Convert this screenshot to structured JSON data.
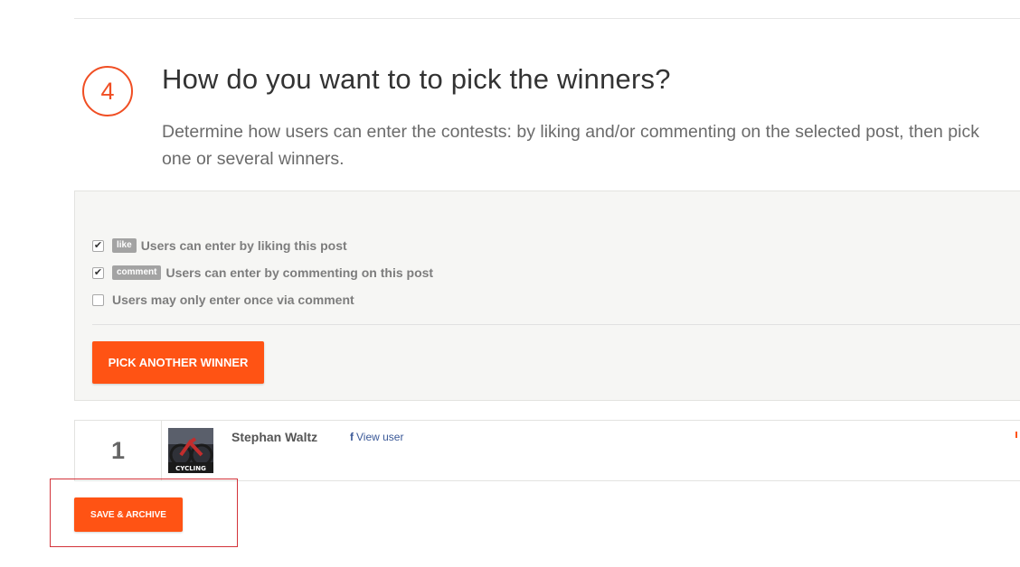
{
  "step": {
    "number": "4",
    "title": "How do you want to to pick the winners?",
    "description": "Determine how users can enter the contests: by liking and/or commenting on the selected post, then pick one or several winners."
  },
  "options": [
    {
      "tag": "like",
      "label": "Users can enter by liking this post",
      "checked": true
    },
    {
      "tag": "comment",
      "label": "Users can enter by commenting on this post",
      "checked": true
    },
    {
      "tag": "",
      "label": "Users may only enter once via comment",
      "checked": false
    }
  ],
  "checkmark": "✔",
  "pick_button_label": "PICK ANOTHER WINNER",
  "winners": [
    {
      "rank": "1",
      "name": "Stephan Waltz",
      "link_label": "View user",
      "link_icon": "f",
      "avatar_caption": "CYCLING"
    }
  ],
  "save_button_label": "SAVE & ARCHIVE",
  "colors": {
    "accent": "#ff5314",
    "step_circle": "#f04e23",
    "facebook": "#3b5998",
    "highlight": "#d3333a"
  }
}
